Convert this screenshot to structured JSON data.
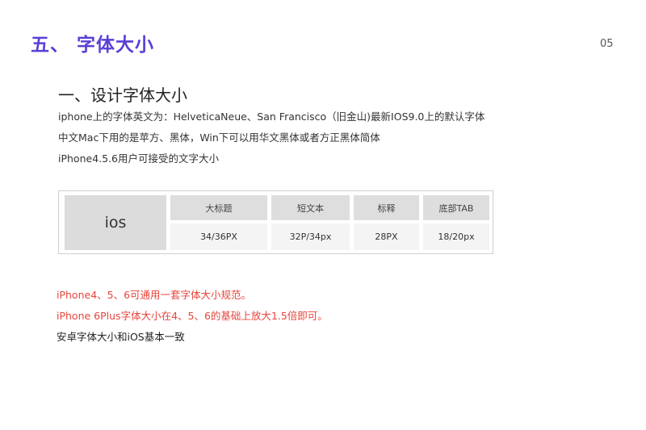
{
  "header": {
    "section_title": "五、 字体大小",
    "page_number": "05"
  },
  "content": {
    "subheading": "一、设计字体大小",
    "paragraphs": [
      "iphone上的字体英文为：HelveticaNeue、San Francisco（旧金山)最新IOS9.0上的默认字体",
      "中文Mac下用的是苹方、黑体，Win下可以用华文黑体或者方正黑体简体",
      "iPhone4.5.6用户可接受的文字大小"
    ]
  },
  "font_table": {
    "platform": "ios",
    "headers": [
      "大标题",
      "短文本",
      "标释",
      "底部TAB"
    ],
    "values": [
      "34/36PX",
      "32P/34px",
      "28PX",
      "18/20px"
    ]
  },
  "notes": [
    "iPhone4、5、6可通用一套字体大小规范。",
    "iPhone 6Plus字体大小在4、5、6的基础上放大1.5倍即可。",
    "安卓字体大小和iOS基本一致"
  ],
  "colors": {
    "title": "#5b3fd6",
    "highlight": "#e8453c"
  }
}
